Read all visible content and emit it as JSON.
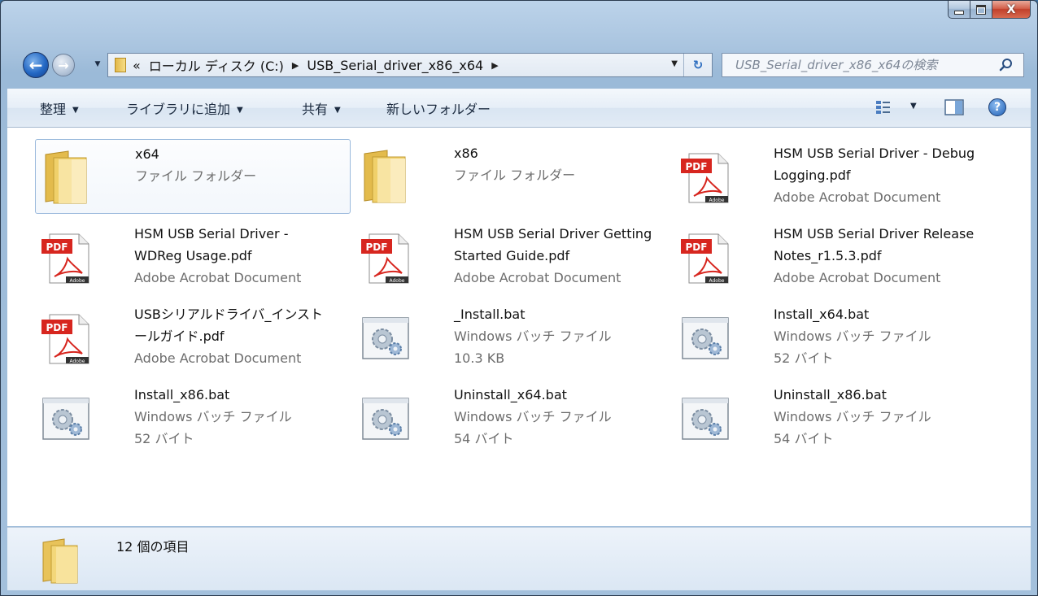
{
  "window": {
    "caption": {
      "minimize": "–",
      "maximize": "□",
      "close": "X"
    }
  },
  "nav": {
    "address": {
      "overflow": "«",
      "crumbs": [
        "ローカル ディスク (C:)",
        "USB_Serial_driver_x86_x64"
      ]
    },
    "search": {
      "placeholder": "USB_Serial_driver_x86_x64の検索"
    }
  },
  "toolbar": {
    "organize": "整理",
    "add_to_library": "ライブラリに追加",
    "share": "共有",
    "new_folder": "新しいフォルダー"
  },
  "files": [
    {
      "name": "x64",
      "line2": "ファイル フォルダー",
      "line3": "",
      "icon": "folder-icon"
    },
    {
      "name": "x86",
      "line2": "ファイル フォルダー",
      "line3": "",
      "icon": "folder-icon"
    },
    {
      "name": "HSM USB Serial Driver - Debug\nLogging.pdf",
      "line2": "",
      "line3": "Adobe Acrobat Document",
      "icon": "pdf-icon"
    },
    {
      "name": "HSM USB Serial Driver -\nWDReg Usage.pdf",
      "line2": "",
      "line3": "Adobe Acrobat Document",
      "icon": "pdf-icon"
    },
    {
      "name": "HSM USB Serial Driver Getting\nStarted Guide.pdf",
      "line2": "",
      "line3": "Adobe Acrobat Document",
      "icon": "pdf-icon"
    },
    {
      "name": "HSM USB Serial Driver Release\nNotes_r1.5.3.pdf",
      "line2": "",
      "line3": "Adobe Acrobat Document",
      "icon": "pdf-icon"
    },
    {
      "name": "USBシリアルドライバ_インスト\nールガイド.pdf",
      "line2": "",
      "line3": "Adobe Acrobat Document",
      "icon": "pdf-icon"
    },
    {
      "name": "_Install.bat",
      "line2": "Windows バッチ ファイル",
      "line3": "10.3 KB",
      "icon": "batch-file-icon"
    },
    {
      "name": "Install_x64.bat",
      "line2": "Windows バッチ ファイル",
      "line3": "52 バイト",
      "icon": "batch-file-icon"
    },
    {
      "name": "Install_x86.bat",
      "line2": "Windows バッチ ファイル",
      "line3": "52 バイト",
      "icon": "batch-file-icon"
    },
    {
      "name": "Uninstall_x64.bat",
      "line2": "Windows バッチ ファイル",
      "line3": "54 バイト",
      "icon": "batch-file-icon"
    },
    {
      "name": "Uninstall_x86.bat",
      "line2": "Windows バッチ ファイル",
      "line3": "54 バイト",
      "icon": "batch-file-icon"
    }
  ],
  "status": {
    "count": "12 個の項目"
  }
}
